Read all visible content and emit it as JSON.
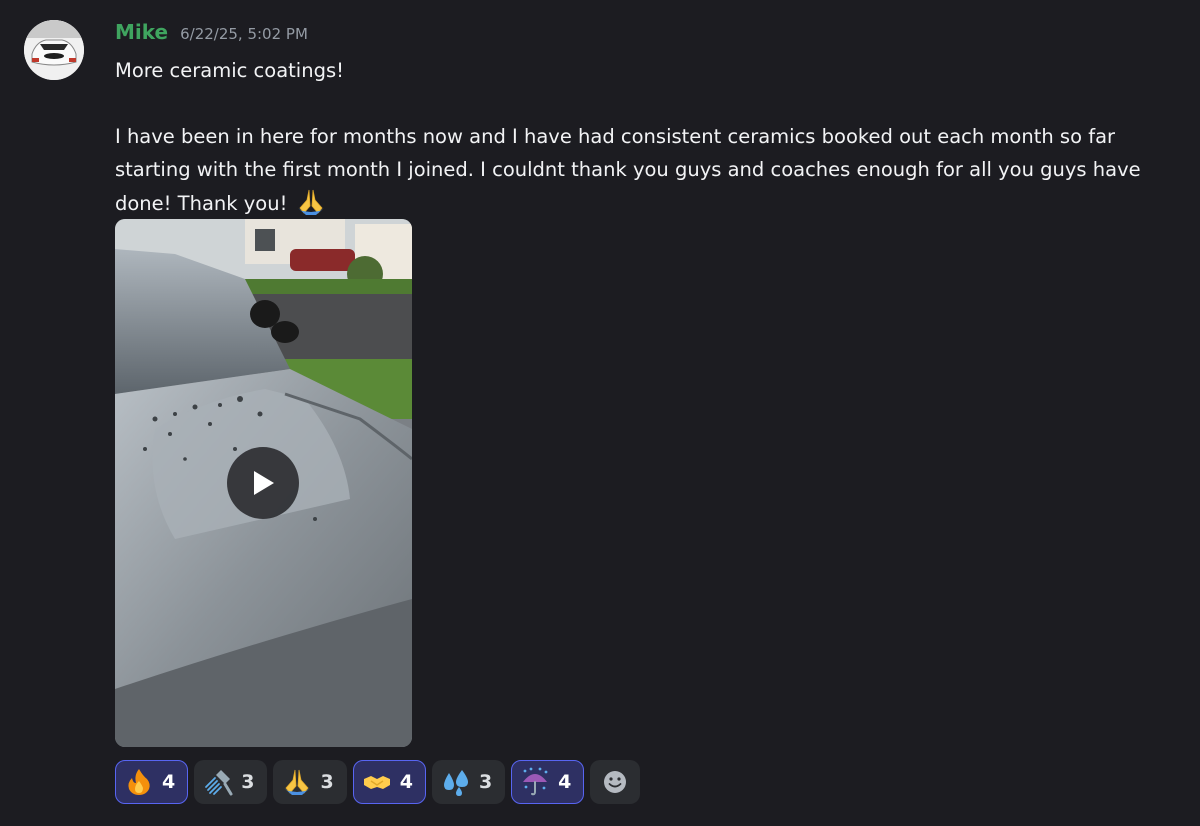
{
  "message": {
    "author": "Mike",
    "timestamp": "6/22/25, 5:02 PM",
    "text_line1": "More ceramic coatings!",
    "text_body": "I have been in here for months now and I have had consistent ceramics booked out each month so far starting with the first month I joined. I couldnt thank you guys and coaches enough for all you guys have done! Thank you! ",
    "inline_emoji": "folded-hands-icon"
  },
  "attachment": {
    "type": "video",
    "play_icon": "play-icon"
  },
  "reactions": [
    {
      "icon": "fire-icon",
      "count": "4",
      "active": true
    },
    {
      "icon": "shower-icon",
      "count": "3",
      "active": false
    },
    {
      "icon": "folded-hands-icon",
      "count": "3",
      "active": false
    },
    {
      "icon": "handshake-icon",
      "count": "4",
      "active": true
    },
    {
      "icon": "sweat-droplets-icon",
      "count": "3",
      "active": false
    },
    {
      "icon": "umbrella-rain-icon",
      "count": "4",
      "active": true
    }
  ],
  "add_reaction_icon": "add-reaction-icon",
  "colors": {
    "background": "#1c1c21",
    "username": "#3fa45f",
    "reaction_active_border": "#5865f2"
  }
}
